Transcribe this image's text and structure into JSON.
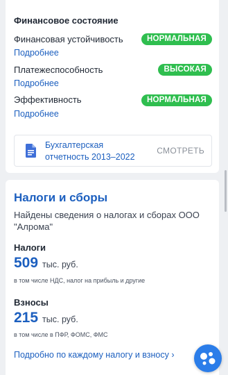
{
  "financial": {
    "title": "Финансовое состояние",
    "metrics": [
      {
        "label": "Финансовая устойчивость",
        "status": "НОРМАЛЬНАЯ",
        "link": "Подробнее"
      },
      {
        "label": "Платежеспособность",
        "status": "ВЫСОКАЯ",
        "link": "Подробнее"
      },
      {
        "label": "Эффективность",
        "status": "НОРМАЛЬНАЯ",
        "link": "Подробнее"
      }
    ],
    "report": {
      "line1": "Бухгалтерская",
      "line2": "отчетность 2013–2022",
      "action": "СМОТРЕТЬ",
      "icon": "document-icon"
    },
    "status_color": "#2fbe4f"
  },
  "taxes": {
    "title": "Налоги и сборы",
    "description": "Найдены сведения о налогах и сборах ООО \"Алрома\"",
    "taxes_label": "Налоги",
    "taxes_amount": "509",
    "taxes_unit": "тыс. руб.",
    "taxes_note": "в том числе НДС, налог на прибыль и другие",
    "fees_label": "Взносы",
    "fees_amount": "215",
    "fees_unit": "тыс. руб.",
    "fees_note": "в том числе в ПФР, ФОМС, ФМС",
    "details_link": "Подробно по каждому налогу и взносу",
    "details_arrow": "›"
  },
  "accent_color": "#1c5fbf",
  "fab": {
    "icon": "chat-assistant-icon",
    "color": "#2b7de9"
  }
}
